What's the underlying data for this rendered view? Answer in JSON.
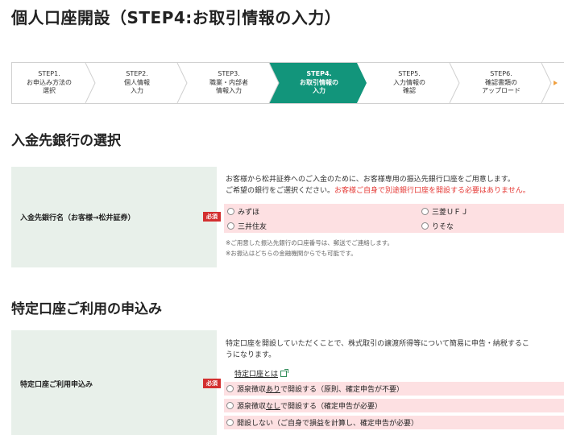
{
  "page_title": "個人口座開設（STEP4:お取引情報の入力）",
  "steps": [
    {
      "label": "STEP1.\nお申込み方法の\n選択"
    },
    {
      "label": "STEP2.\n個人情報\n入力"
    },
    {
      "label": "STEP3.\n職業・内部者\n情報入力"
    },
    {
      "label": "STEP4.\nお取引情報の\n入力"
    },
    {
      "label": "STEP5.\n入力情報の\n確認"
    },
    {
      "label": "STEP6.\n確認書類の\nアップロード"
    }
  ],
  "active_step": 4,
  "colors": {
    "accent": "#12957b",
    "required": "#d32f2f",
    "warning_text": "#e53935",
    "option_bg": "#fde0e2",
    "label_bg": "#e8f0ea"
  },
  "bank_section": {
    "title": "入金先銀行の選択",
    "label": "入金先銀行名（お客様→松井証券）",
    "required_badge": "必須",
    "desc_line1": "お客様から松井証券へのご入金のために、お客様専用の振込先銀行口座をご用意します。",
    "desc_line2_plain": "ご希望の銀行をご選択ください。",
    "desc_line2_warn": "お客様ご自身で別途銀行口座を開設する必要はありません。",
    "options": [
      "みずほ",
      "三菱ＵＦＪ",
      "三井住友",
      "りそな"
    ],
    "note1": "※ご用意した振込先銀行の口座番号は、郵送でご連絡します。",
    "note2": "※お振込はどちらの金融機関からでも可能です。"
  },
  "tokutei_section": {
    "title": "特定口座ご利用の申込み",
    "label": "特定口座ご利用申込み",
    "required_badge": "必須",
    "desc_line1": "特定口座を開設していただくことで、株式取引の譲渡所得等について簡易に申告・納税するこ",
    "desc_line2": "うになります。",
    "link": "特定口座とは",
    "options": [
      {
        "pre": "源泉徴収",
        "ul": "あり",
        "post": "で開設する（原則、確定申告が不要）"
      },
      {
        "pre": "源泉徴収",
        "ul": "なし",
        "post": "で開設する（確定申告が必要）"
      },
      {
        "pre": "",
        "ul": "",
        "post": "開設しない（ご自身で損益を計算し、確定申告が必要）"
      }
    ]
  }
}
